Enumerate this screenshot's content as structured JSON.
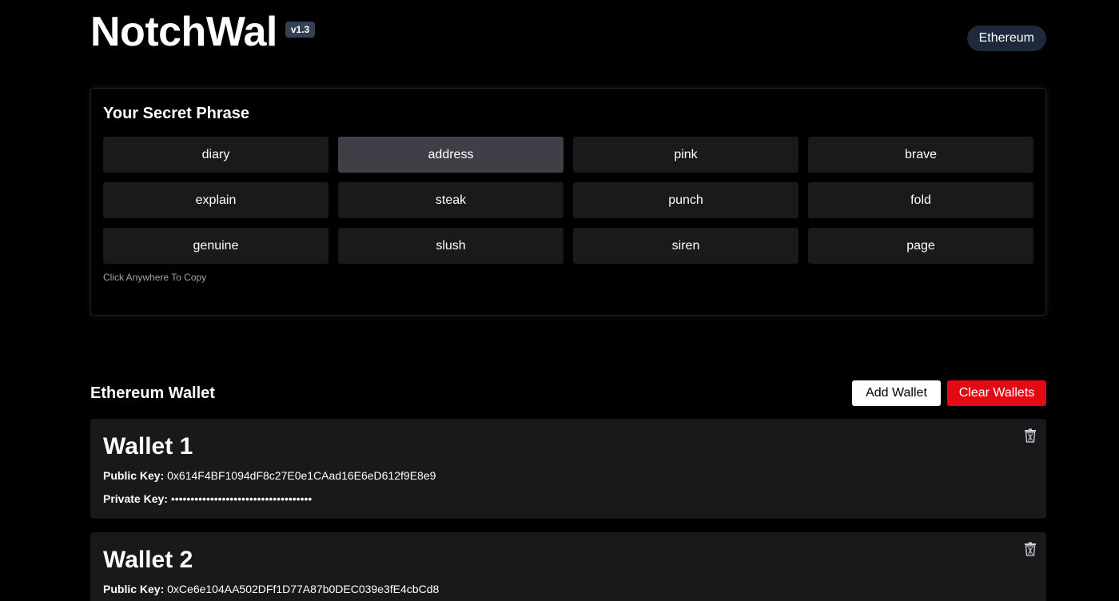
{
  "header": {
    "title": "NotchWal",
    "version": "v1.3",
    "network": "Ethereum"
  },
  "phrase": {
    "title": "Your Secret Phrase",
    "words": [
      "diary",
      "address",
      "pink",
      "brave",
      "explain",
      "steak",
      "punch",
      "fold",
      "genuine",
      "slush",
      "siren",
      "page"
    ],
    "hint": "Click Anywhere To Copy"
  },
  "wallets_section": {
    "title": "Ethereum Wallet",
    "add_label": "Add Wallet",
    "clear_label": "Clear Wallets"
  },
  "wallets": [
    {
      "name": "Wallet 1",
      "public_label": "Public Key:",
      "public_key": "0x614F4BF1094dF8c27E0e1CAad16E6eD612f9E8e9",
      "private_label": "Private Key:",
      "private_key": "••••••••••••••••••••••••••••••••••••"
    },
    {
      "name": "Wallet 2",
      "public_label": "Public Key:",
      "public_key": "0xCe6e104AA502DFf1D77A87b0DEC039e3fE4cbCd8"
    }
  ],
  "colors": {
    "background": "#000000",
    "card": "#19191b",
    "word_tile": "#1a1a1d",
    "word_tile_active": "#3f3f48",
    "danger": "#e50914",
    "badge": "#334155",
    "network_pill": "#1e293b"
  },
  "icons": {
    "delete": "trash-icon"
  }
}
